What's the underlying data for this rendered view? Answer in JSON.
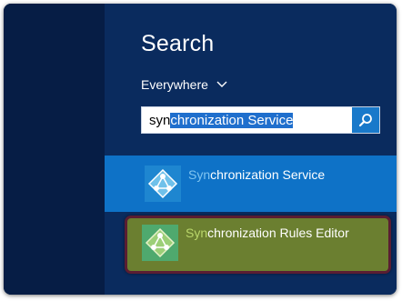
{
  "search": {
    "title": "Search",
    "scope": "Everywhere",
    "query_typed": "syn",
    "query_completion": "chronization Service"
  },
  "results": [
    {
      "match": "Syn",
      "rest": "chronization Service",
      "state": "selected"
    },
    {
      "match": "Syn",
      "rest": "chronization Rules Editor",
      "state": "highlighted"
    }
  ],
  "colors": {
    "background": "#0a2b5e",
    "selected_result": "#0e72c7",
    "highlighted_result": "#6b7f30",
    "highlight_border": "#5a1d32",
    "search_button": "#1979ca"
  },
  "icons": {
    "scope": "chevron-down-icon",
    "search": "magnifier-icon",
    "app": "synchronization-app-icon"
  }
}
